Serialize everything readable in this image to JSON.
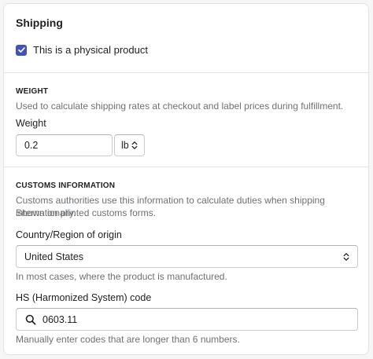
{
  "shipping": {
    "title": "Shipping",
    "physical_product_label": "This is a physical product",
    "physical_product_checked": true
  },
  "weight": {
    "heading": "WEIGHT",
    "help": "Used to calculate shipping rates at checkout and label prices during fulfillment.",
    "field_label": "Weight",
    "value": "0.2",
    "unit": "lb"
  },
  "customs": {
    "heading": "CUSTOMS INFORMATION",
    "help_line1": "Customs authorities use this information to calculate duties when shipping internationally.",
    "help_line2": "Shown on printed customs forms.",
    "country_label": "Country/Region of origin",
    "country_value": "United States",
    "country_help": "In most cases, where the product is manufactured.",
    "hs_label": "HS (Harmonized System) code",
    "hs_value": "0603.11",
    "hs_help": "Manually enter codes that are longer than 6 numbers."
  },
  "colors": {
    "checkbox_accent": "#4452b8",
    "help_text": "#6d7175",
    "border": "#c9cccf"
  },
  "icons": {
    "checkbox": "check-icon",
    "select": "select-chevron-icon",
    "search": "search-icon"
  }
}
